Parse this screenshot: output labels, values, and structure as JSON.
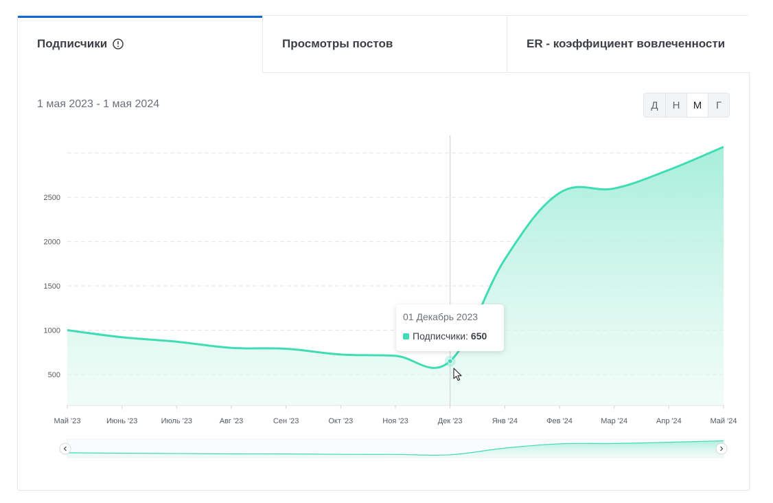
{
  "tabs": [
    {
      "label": "Подписчики",
      "active": true
    },
    {
      "label": "Просмотры постов",
      "active": false
    },
    {
      "label": "ER - коэффициент вовлеченности",
      "active": false
    }
  ],
  "date_range": "1 мая 2023 - 1 мая 2024",
  "period_buttons": [
    {
      "label": "Д",
      "active": false
    },
    {
      "label": "Н",
      "active": false
    },
    {
      "label": "М",
      "active": true
    },
    {
      "label": "Г",
      "active": false
    }
  ],
  "tooltip": {
    "date": "01 Декабрь 2023",
    "series_label": "Подписчики:",
    "value": "650"
  },
  "colors": {
    "accent": "#1466d8",
    "series": "#40dcb4",
    "series_fill": "#b3f0e0"
  },
  "icons": {
    "info": "info-circle-icon",
    "navigator_left": "chevron-left-icon",
    "navigator_right": "chevron-right-icon",
    "cursor": "mouse-pointer-icon"
  },
  "chart_data": {
    "type": "area",
    "title": "",
    "xlabel": "",
    "ylabel": "",
    "categories": [
      "Май '23",
      "Июнь '23",
      "Июль '23",
      "Авг '23",
      "Сен '23",
      "Окт '23",
      "Ноя '23",
      "Дек '23",
      "Янв '24",
      "Фев '24",
      "Мар '24",
      "Апр '24",
      "Май '24"
    ],
    "series": [
      {
        "name": "Подписчики",
        "values": [
          1000,
          920,
          870,
          800,
          790,
          725,
          710,
          650,
          1800,
          2550,
          2600,
          2810,
          3070
        ]
      }
    ],
    "y_ticks": [
      500,
      1000,
      1500,
      2000,
      2500
    ],
    "ylim": [
      150,
      3200
    ],
    "grid": true,
    "legend": "none",
    "highlighted_point": {
      "x": "Дек '23",
      "y": 650
    }
  }
}
